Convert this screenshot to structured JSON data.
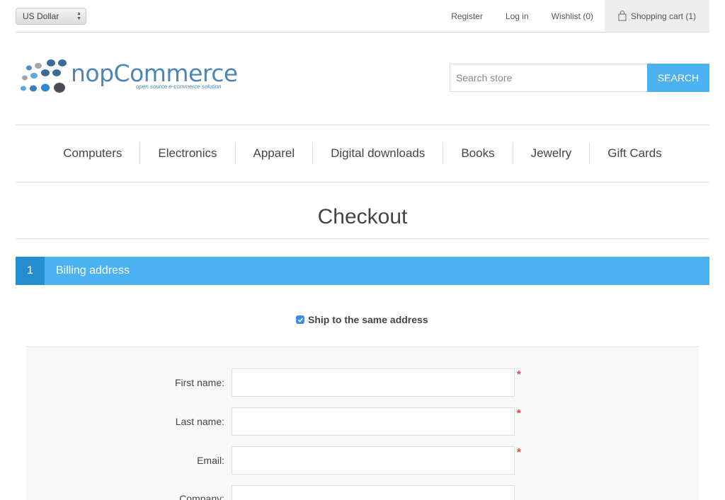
{
  "header": {
    "currency": "US Dollar",
    "links": {
      "register": "Register",
      "login": "Log in",
      "wishlist": "Wishlist (0)",
      "cart": "Shopping cart (1)"
    }
  },
  "logo": {
    "name": "nopCommerce",
    "tagline": "open source e-commerce solution"
  },
  "search": {
    "placeholder": "Search store",
    "button": "SEARCH"
  },
  "menu": [
    "Computers",
    "Electronics",
    "Apparel",
    "Digital downloads",
    "Books",
    "Jewelry",
    "Gift Cards"
  ],
  "page": {
    "title": "Checkout"
  },
  "step": {
    "number": "1",
    "title": "Billing address"
  },
  "ship_same": {
    "label": "Ship to the same address",
    "checked": true
  },
  "form": {
    "fields": [
      {
        "label": "First name:",
        "required": "*"
      },
      {
        "label": "Last name:",
        "required": "*"
      },
      {
        "label": "Email:",
        "required": "*"
      },
      {
        "label": "Company:",
        "required": ""
      }
    ]
  },
  "colors": {
    "accent": "#4ab2f1",
    "accent_dark": "#248ece",
    "required": "#e4434b"
  }
}
